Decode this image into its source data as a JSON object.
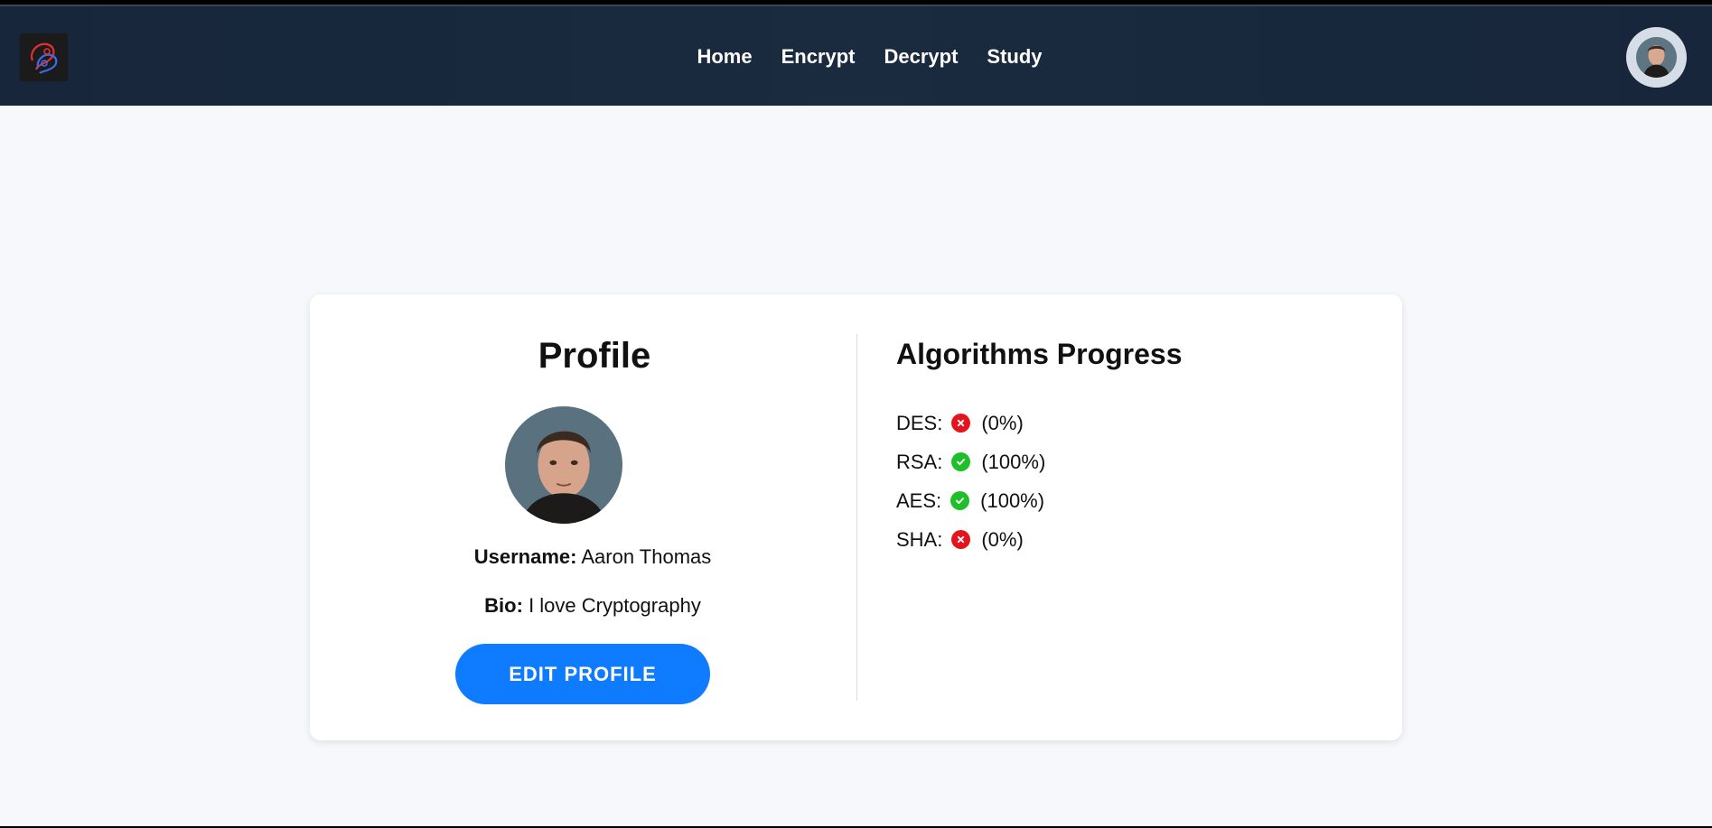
{
  "nav": {
    "links": [
      "Home",
      "Encrypt",
      "Decrypt",
      "Study"
    ]
  },
  "profile": {
    "title": "Profile",
    "username_label": "Username:",
    "username_value": "Aaron Thomas",
    "bio_label": "Bio:",
    "bio_value": "I love Cryptography",
    "edit_button": "EDIT PROFILE"
  },
  "progress": {
    "title": "Algorithms Progress",
    "algorithms": [
      {
        "name": "DES:",
        "status": "incomplete",
        "status_icon": "x-icon",
        "percent": "(0%)"
      },
      {
        "name": "RSA:",
        "status": "complete",
        "status_icon": "check-icon",
        "percent": "(100%)"
      },
      {
        "name": "AES:",
        "status": "complete",
        "status_icon": "check-icon",
        "percent": "(100%)"
      },
      {
        "name": "SHA:",
        "status": "incomplete",
        "status_icon": "x-icon",
        "percent": "(0%)"
      }
    ]
  },
  "colors": {
    "navbar": "#17263a",
    "accent": "#0f7bff",
    "success": "#1fbf29",
    "failure": "#e5141c",
    "background": "#f6f8fc"
  }
}
